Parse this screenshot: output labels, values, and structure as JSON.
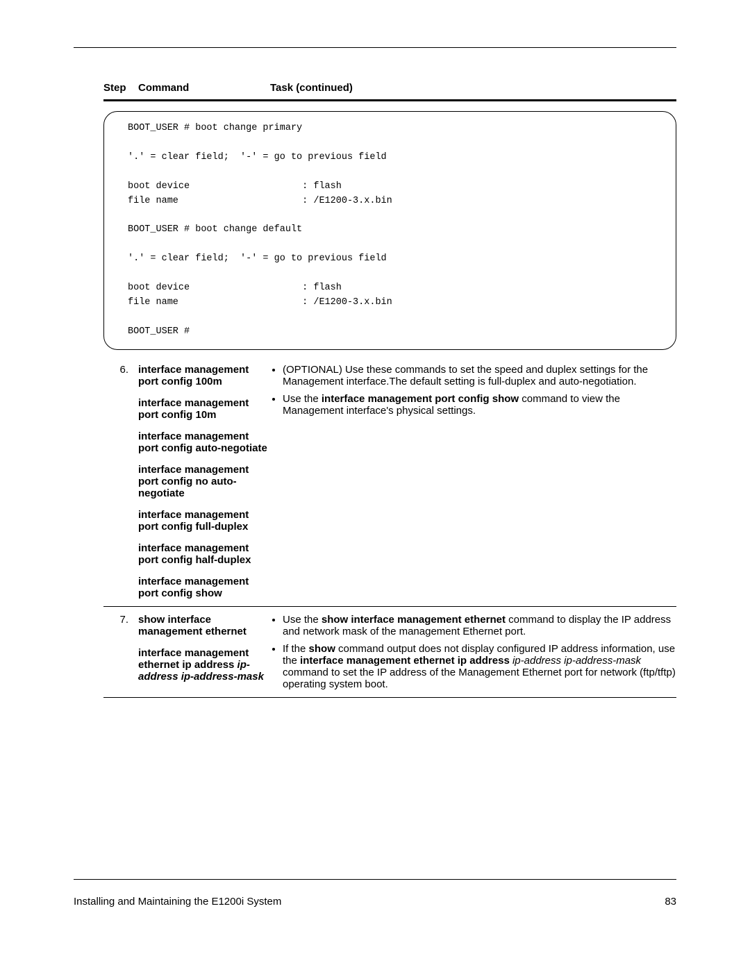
{
  "table_headers": {
    "step": "Step",
    "command": "Command",
    "task": "Task (continued)"
  },
  "code_block": "BOOT_USER # boot change primary\n\n'.' = clear field;  '-' = go to previous field\n\nboot device                    : flash\nfile name                      : /E1200-3.x.bin\n\nBOOT_USER # boot change default\n\n'.' = clear field;  '-' = go to previous field\n\nboot device                    : flash\nfile name                      : /E1200-3.x.bin\n\nBOOT_USER #",
  "rows": [
    {
      "step": "6.",
      "commands": [
        "interface management port config 100m",
        "interface management port config 10m",
        "interface management port config auto-negotiate",
        "interface management port config no auto-negotiate",
        "interface management port config full-duplex",
        "interface management port config half-duplex",
        "interface management port config show"
      ],
      "task": {
        "b1_text": "(OPTIONAL) Use these commands to set the speed and duplex settings for the Management interface.The default setting is full-duplex and auto-negotiation.",
        "b2_pre": "Use the ",
        "b2_bold": "interface management port config show",
        "b2_post": " command to view the Management interface's physical settings."
      }
    },
    {
      "step": "7.",
      "commands_html": {
        "c1": "show interface management ethernet",
        "c2_pre": "interface management ethernet ip address ",
        "c2_it1": "ip-address",
        "c2_sp": " ",
        "c2_it2": "ip-address-mask"
      },
      "task": {
        "b1_pre": "Use the ",
        "b1_bold": "show interface management ethernet",
        "b1_post": " command to display the IP address and network mask of the management Ethernet port.",
        "b2_pre": "If the ",
        "b2_bold1": "show",
        "b2_mid1": " command output does not display configured IP address information, use the ",
        "b2_bold2": "interface management ethernet ip address",
        "b2_sp": " ",
        "b2_it": "ip-address ip-address-mask",
        "b2_post": " command to set the IP address of the Management Ethernet port for network (ftp/tftp) operating system boot."
      }
    }
  ],
  "footer": {
    "left": "Installing and Maintaining the E1200i System",
    "right": "83"
  }
}
